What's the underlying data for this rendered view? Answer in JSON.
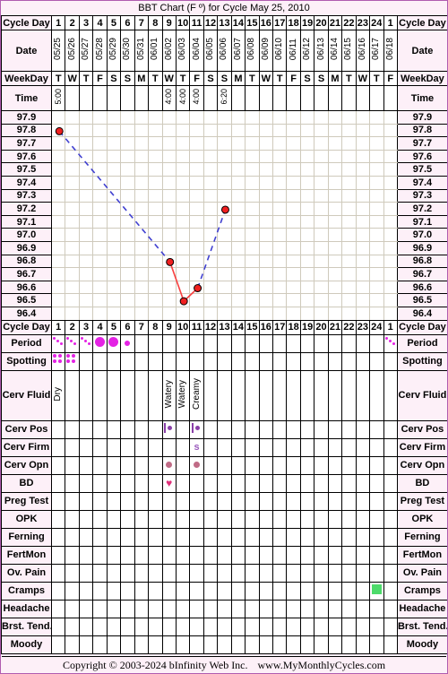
{
  "title": "BBT Chart (F º) for Cycle May 25, 2010",
  "labels": {
    "cycle_day": "Cycle Day",
    "date": "Date",
    "weekday": "WeekDay",
    "time": "Time",
    "period": "Period",
    "spotting": "Spotting",
    "cerv_fluid": "Cerv Fluid",
    "cerv_pos": "Cerv Pos",
    "cerv_firm": "Cerv Firm",
    "cerv_opn": "Cerv Opn",
    "bd": "BD",
    "preg_test": "Preg Test",
    "opk": "OPK",
    "ferning": "Ferning",
    "fertmon": "FertMon",
    "ov_pain": "Ov. Pain",
    "cramps": "Cramps",
    "headache": "Headache",
    "brst_tend": "Brst. Tend.",
    "moody": "Moody"
  },
  "colors": {
    "plot_background": "#fdf8e3",
    "grid_line": "#cfcabc",
    "label_background": "#fdf0f8",
    "date_background": "#faf6e0",
    "point_fill": "#f02020",
    "point_stroke": "#000000",
    "solid_line": "#f84040",
    "dashed_line": "#4040d0",
    "period_marker": "#e422e4",
    "cerv_pos_marker": "#8a3fa8",
    "cerv_opn_marker": "#c06b86",
    "bd_heart": "#e0307a",
    "cramps_marker": "#4ddb6a",
    "page_border": "#b05cb0"
  },
  "chart_data": {
    "type": "line",
    "title": "BBT Chart (F º) for Cycle May 25, 2010",
    "xlabel": "Cycle Day",
    "ylabel": "Temperature (F º)",
    "ylim": [
      96.4,
      97.9
    ],
    "grid": true,
    "legend": null,
    "y_ticks": [
      "97.9",
      "97.8",
      "97.7",
      "97.6",
      "97.5",
      "97.4",
      "97.3",
      "97.2",
      "97.1",
      "97.0",
      "96.9",
      "96.8",
      "96.7",
      "96.6",
      "96.5",
      "96.4"
    ],
    "cycle_days": [
      "1",
      "2",
      "3",
      "4",
      "5",
      "6",
      "7",
      "8",
      "9",
      "10",
      "11",
      "12",
      "13",
      "14",
      "15",
      "16",
      "17",
      "18",
      "19",
      "20",
      "21",
      "22",
      "23",
      "24",
      "1"
    ],
    "dates": [
      "05/25",
      "05/26",
      "05/27",
      "05/28",
      "05/29",
      "05/30",
      "05/31",
      "06/01",
      "06/02",
      "06/03",
      "06/04",
      "06/05",
      "06/06",
      "06/07",
      "06/08",
      "06/09",
      "06/10",
      "06/11",
      "06/12",
      "06/13",
      "06/14",
      "06/15",
      "06/16",
      "06/17",
      "06/18"
    ],
    "weekdays": [
      "T",
      "W",
      "T",
      "F",
      "S",
      "S",
      "M",
      "T",
      "W",
      "T",
      "F",
      "S",
      "S",
      "M",
      "T",
      "W",
      "T",
      "F",
      "S",
      "S",
      "M",
      "T",
      "W",
      "T",
      "F"
    ],
    "times": [
      "5:00",
      "",
      "",
      "",
      "",
      "",
      "",
      "",
      "4:00",
      "4:00",
      "4:00",
      "",
      "6:20",
      "",
      "",
      "",
      "",
      "",
      "",
      "",
      "",
      "",
      "",
      "",
      ""
    ],
    "x": [
      1,
      9,
      10,
      11,
      13
    ],
    "values": [
      97.8,
      96.8,
      96.5,
      96.6,
      97.2
    ],
    "segments": [
      {
        "from": 1,
        "to": 9,
        "style": "dashed"
      },
      {
        "from": 9,
        "to": 10,
        "style": "solid"
      },
      {
        "from": 10,
        "to": 11,
        "style": "solid"
      },
      {
        "from": 11,
        "to": 13,
        "style": "dashed"
      }
    ]
  },
  "rows": {
    "period": [
      "light",
      "light",
      "light",
      "heavy",
      "heavy",
      "medium",
      "",
      "",
      "",
      "",
      "",
      "",
      "",
      "",
      "",
      "",
      "",
      "",
      "",
      "",
      "",
      "",
      "",
      "",
      "light"
    ],
    "spotting": [
      "yes",
      "yes",
      "",
      "",
      "",
      "",
      "",
      "",
      "",
      "",
      "",
      "",
      "",
      "",
      "",
      "",
      "",
      "",
      "",
      "",
      "",
      "",
      "",
      "",
      ""
    ],
    "cerv_fluid": [
      "Dry",
      "",
      "",
      "",
      "",
      "",
      "",
      "",
      "Watery",
      "Watery",
      "Creamy",
      "",
      "",
      "",
      "",
      "",
      "",
      "",
      "",
      "",
      "",
      "",
      "",
      "",
      ""
    ],
    "cerv_pos": [
      "",
      "",
      "",
      "",
      "",
      "",
      "",
      "",
      "mark",
      "",
      "mark",
      "",
      "",
      "",
      "",
      "",
      "",
      "",
      "",
      "",
      "",
      "",
      "",
      "",
      ""
    ],
    "cerv_firm": [
      "",
      "",
      "",
      "",
      "",
      "",
      "",
      "",
      "",
      "",
      "s",
      "",
      "",
      "",
      "",
      "",
      "",
      "",
      "",
      "",
      "",
      "",
      "",
      "",
      ""
    ],
    "cerv_opn": [
      "",
      "",
      "",
      "",
      "",
      "",
      "",
      "",
      "dot",
      "",
      "dot",
      "",
      "",
      "",
      "",
      "",
      "",
      "",
      "",
      "",
      "",
      "",
      "",
      "",
      ""
    ],
    "bd": [
      "",
      "",
      "",
      "",
      "",
      "",
      "",
      "",
      "heart",
      "",
      "",
      "",
      "",
      "",
      "",
      "",
      "",
      "",
      "",
      "",
      "",
      "",
      "",
      "",
      ""
    ],
    "preg_test": [
      "",
      "",
      "",
      "",
      "",
      "",
      "",
      "",
      "",
      "",
      "",
      "",
      "",
      "",
      "",
      "",
      "",
      "",
      "",
      "",
      "",
      "",
      "",
      "",
      ""
    ],
    "opk": [
      "",
      "",
      "",
      "",
      "",
      "",
      "",
      "",
      "",
      "",
      "",
      "",
      "",
      "",
      "",
      "",
      "",
      "",
      "",
      "",
      "",
      "",
      "",
      "",
      ""
    ],
    "ferning": [
      "",
      "",
      "",
      "",
      "",
      "",
      "",
      "",
      "",
      "",
      "",
      "",
      "",
      "",
      "",
      "",
      "",
      "",
      "",
      "",
      "",
      "",
      "",
      "",
      ""
    ],
    "fertmon": [
      "",
      "",
      "",
      "",
      "",
      "",
      "",
      "",
      "",
      "",
      "",
      "",
      "",
      "",
      "",
      "",
      "",
      "",
      "",
      "",
      "",
      "",
      "",
      "",
      ""
    ],
    "ov_pain": [
      "",
      "",
      "",
      "",
      "",
      "",
      "",
      "",
      "",
      "",
      "",
      "",
      "",
      "",
      "",
      "",
      "",
      "",
      "",
      "",
      "",
      "",
      "",
      "",
      ""
    ],
    "cramps": [
      "",
      "",
      "",
      "",
      "",
      "",
      "",
      "",
      "",
      "",
      "",
      "",
      "",
      "",
      "",
      "",
      "",
      "",
      "",
      "",
      "",
      "",
      "",
      "green",
      ""
    ],
    "headache": [
      "",
      "",
      "",
      "",
      "",
      "",
      "",
      "",
      "",
      "",
      "",
      "",
      "",
      "",
      "",
      "",
      "",
      "",
      "",
      "",
      "",
      "",
      "",
      "",
      ""
    ],
    "brst_tend": [
      "",
      "",
      "",
      "",
      "",
      "",
      "",
      "",
      "",
      "",
      "",
      "",
      "",
      "",
      "",
      "",
      "",
      "",
      "",
      "",
      "",
      "",
      "",
      "",
      ""
    ],
    "moody": [
      "",
      "",
      "",
      "",
      "",
      "",
      "",
      "",
      "",
      "",
      "",
      "",
      "",
      "",
      "",
      "",
      "",
      "",
      "",
      "",
      "",
      "",
      "",
      "",
      ""
    ]
  },
  "footer": {
    "copyright": "Copyright © 2003-2024 bInfinity Web Inc.",
    "website": "www.MyMonthlyCycles.com"
  }
}
